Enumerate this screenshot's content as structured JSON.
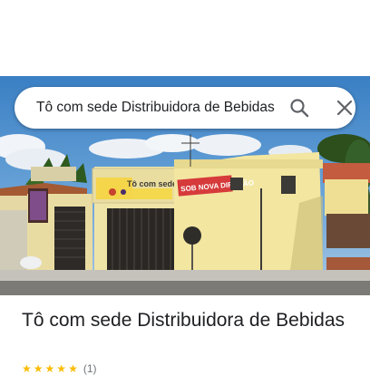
{
  "search": {
    "value": "Tô com sede Distribuidora de Bebidas",
    "search_icon": "search-icon",
    "clear_icon": "close-icon"
  },
  "photo": {
    "sign_logo_text": "Tô com sede",
    "banner_text": "SOB NOVA DIREÇÃO"
  },
  "place": {
    "title": "Tô com sede Distribuidora de Bebidas",
    "stars": 5,
    "rating_count": "(1)"
  },
  "colors": {
    "sky": "#3f86c8",
    "wall": "#f3e6a1",
    "banner": "#d63a3a",
    "star": "#fbbc04"
  }
}
